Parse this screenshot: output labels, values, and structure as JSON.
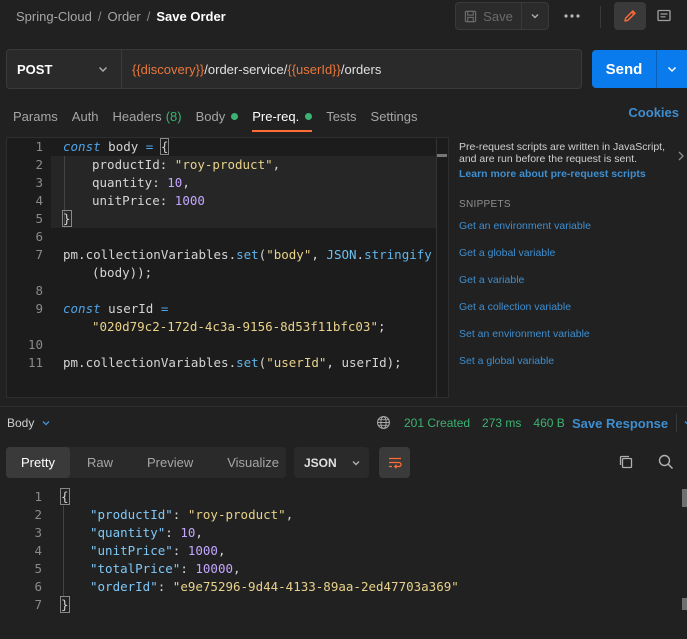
{
  "breadcrumb": {
    "root": "Spring-Cloud",
    "folder": "Order",
    "current": "Save Order"
  },
  "toolbar": {
    "save_label": "Save",
    "more_label": "•••"
  },
  "request": {
    "method": "POST",
    "url_var_1": "{{discovery}}",
    "url_mid": "/order-service/",
    "url_var_2": "{{userId}}",
    "url_end": "/orders",
    "send_label": "Send"
  },
  "tabs": {
    "params": "Params",
    "auth": "Auth",
    "headers": "Headers",
    "headers_count": "(8)",
    "body": "Body",
    "prereq": "Pre-req.",
    "tests": "Tests",
    "settings": "Settings",
    "cookies": "Cookies"
  },
  "editor": {
    "l1_kw": "const",
    "l1_var": " body ",
    "l1_op": "=",
    "l1_br": "{",
    "l2_key": "productId: ",
    "l2_val": "\"roy-product\"",
    "l2_end": ",",
    "l3_key": "quantity: ",
    "l3_val": "10",
    "l3_end": ",",
    "l4_key": "unitPrice: ",
    "l4_val": "1000",
    "l5_br": "}",
    "l7_a": "pm.collectionVariables.",
    "l7_fn": "set",
    "l7_b": "(",
    "l7_str": "\"body\"",
    "l7_c": ", ",
    "l7_json": "JSON",
    "l7_d": ".",
    "l7_fn2": "stringify",
    "l7_wrap": "(body));",
    "l9_kw": "const",
    "l9_var": " userId ",
    "l9_op": "=",
    "l9_wrap_str": "\"020d79c2-172d-4c3a-9156-8d53f11bfc03\"",
    "l9_wrap_end": ";",
    "l11_a": "pm.collectionVariables.",
    "l11_fn": "set",
    "l11_b": "(",
    "l11_str": "\"userId\"",
    "l11_c": ", userId);",
    "line_numbers": [
      "1",
      "2",
      "3",
      "4",
      "5",
      "6",
      "7",
      "8",
      "9",
      "10",
      "11"
    ]
  },
  "side": {
    "description": "Pre-request scripts are written in JavaScript, and are run before the request is sent.",
    "learn_more": "Learn more about pre-request scripts",
    "snippets_title": "SNIPPETS",
    "snippets": [
      "Get an environment variable",
      "Get a global variable",
      "Get a variable",
      "Get a collection variable",
      "Set an environment variable",
      "Set a global variable"
    ]
  },
  "response": {
    "title": "Body",
    "status": "201 Created",
    "time": "273 ms",
    "size": "460 B",
    "save_label": "Save Response",
    "views": [
      "Pretty",
      "Raw",
      "Preview",
      "Visualize"
    ],
    "format": "JSON",
    "line_numbers": [
      "1",
      "2",
      "3",
      "4",
      "5",
      "6",
      "7"
    ],
    "open_br": "{",
    "close_br": "}",
    "fields": [
      {
        "key": "\"productId\"",
        "sep": ": ",
        "val": "\"roy-product\"",
        "end": ","
      },
      {
        "key": "\"quantity\"",
        "sep": ": ",
        "val": "10",
        "end": ","
      },
      {
        "key": "\"unitPrice\"",
        "sep": ": ",
        "val": "1000",
        "end": ","
      },
      {
        "key": "\"totalPrice\"",
        "sep": ": ",
        "val": "10000",
        "end": ","
      },
      {
        "key": "\"orderId\"",
        "sep": ": ",
        "val": "\"e9e75296-9d44-4133-89aa-2ed47703a369\"",
        "end": ""
      }
    ]
  },
  "colors": {
    "accent": "#ff6c37",
    "send": "#097bed",
    "link": "#3e8ed0",
    "success": "#3cb371",
    "variable": "#e8773c"
  },
  "icons": {
    "save": "save-icon",
    "more": "more-dots-icon",
    "edit": "pencil-icon",
    "comment": "comment-icon",
    "globe": "globe-icon",
    "wrap": "wrap-lines-icon",
    "copy": "copy-icon",
    "search": "search-icon"
  }
}
